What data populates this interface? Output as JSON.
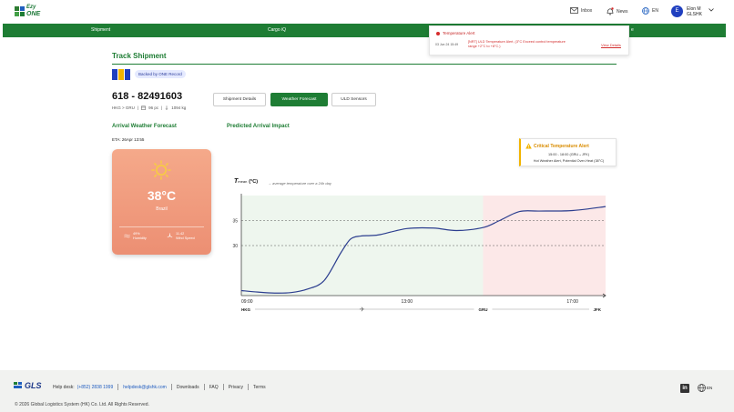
{
  "brand": {
    "line1": "Ezy",
    "line2": "ONE"
  },
  "header": {
    "inbox": "Inbox",
    "news": "News",
    "lang": "EN",
    "avatar_initial": "E",
    "user_name": "Elon M",
    "user_org": "GLSHK"
  },
  "nav": {
    "items": [
      "Shipment",
      "Cargo iQ",
      "e"
    ]
  },
  "alert": {
    "title": "Temperature Alert",
    "time": "03 Jun 24 15:49",
    "message": "[NRT] ULD Temperature Alert, (3°C Exceed control temperature range +2°C to +8°C.)",
    "view": "View Details"
  },
  "track": {
    "title": "Track Shipment",
    "badge": "Backed by ONE Record",
    "awb": "618 - 82491603",
    "route": "HKG > GRU",
    "pieces": "96 pc",
    "weight": "1094 kg",
    "tabs": [
      "Shipment Details",
      "Weather Forecast",
      "ULD Sensors"
    ]
  },
  "forecast": {
    "arrival_label": "Arrival Weather Forecast",
    "impact_label": "Predicted Arrival Impact",
    "eta": "ETA: 26Apr 13:55",
    "temp": "38°C",
    "city": "Brazil",
    "humidity_val": "49%",
    "humidity_label": "Humidity",
    "wind_val": "11.42",
    "wind_label": "Wind Speed"
  },
  "critical": {
    "title": "Critical Temperature Alert",
    "line1": "15:00 - 18:00 (GRU→JFK)",
    "line2": "Hot Weather Alert, Potential Over-Heat (38°C)"
  },
  "chart_data": {
    "type": "line",
    "title": "T",
    "title_sub": "mean",
    "title_unit": "(°C)",
    "note": "→ average temperature over a 24h day",
    "x_ticks": [
      "09:00",
      "13:00",
      "17:00"
    ],
    "y_ticks": [
      35,
      30
    ],
    "ylim": [
      20,
      40
    ],
    "airports": [
      "HKG",
      "GRU",
      "JFK"
    ],
    "x": [
      0,
      0.5,
      1,
      1.5,
      2,
      2.5,
      3,
      3.3,
      3.6,
      3.9,
      4.2,
      5,
      5.8,
      6.5,
      7.3,
      7.8,
      8.4,
      9,
      10,
      11
    ],
    "values": [
      21.0,
      20.7,
      20.5,
      20.6,
      21.3,
      23.0,
      28.5,
      31.3,
      31.9,
      32.0,
      32.2,
      33.4,
      33.5,
      33.0,
      33.6,
      35.0,
      36.8,
      36.9,
      37.0,
      37.8
    ],
    "zones": [
      {
        "from": 0,
        "to": 7.3,
        "color": "#eef6ee"
      },
      {
        "from": 7.3,
        "to": 11,
        "color": "#fce8e8"
      }
    ]
  },
  "footer": {
    "logo": "GLS",
    "helpdesk_label": "Help desk:",
    "phone": "(+852) 2838 1999",
    "email": "helpdesk@glshk.com",
    "links": [
      "Downloads",
      "FAQ",
      "Privacy",
      "Terms"
    ],
    "copyright": "© 2026 Global Logistics System (HK) Co. Ltd. All Rights Reserved.",
    "linkedin": "in",
    "lang": "EN"
  }
}
